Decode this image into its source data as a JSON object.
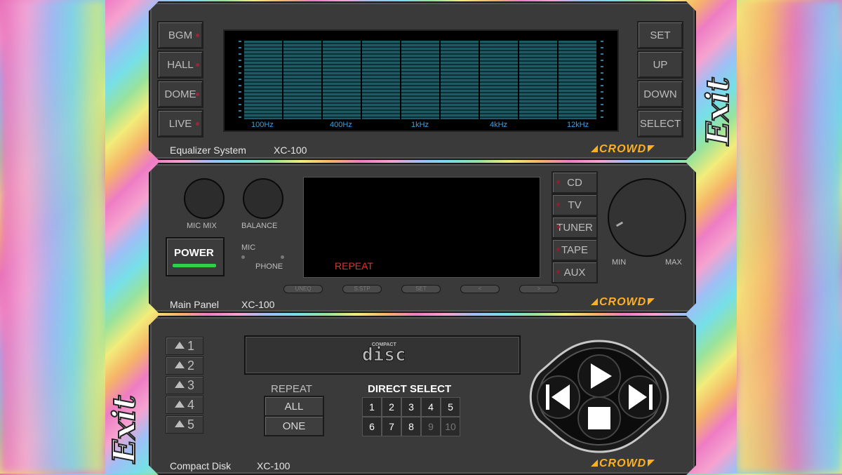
{
  "exit_top": "Exit",
  "exit_bottom": "Exit",
  "equalizer": {
    "modes": [
      "BGM",
      "HALL",
      "DOME",
      "LIVE"
    ],
    "controls": [
      "SET",
      "UP",
      "DOWN",
      "SELECT"
    ],
    "freq_labels": [
      "100Hz",
      "400Hz",
      "1kHz",
      "4kHz",
      "12kHz"
    ],
    "footer_title": "Equalizer System",
    "footer_model": "XC-100",
    "brand": "CROWD"
  },
  "main": {
    "knob1_label": "MIC MIX",
    "knob2_label": "BALANCE",
    "power_label": "POWER",
    "jack_mic": "MIC",
    "jack_phone": "PHONE",
    "display_text": "REPEAT",
    "sources": [
      "CD",
      "TV",
      "TUNER",
      "TAPE",
      "AUX"
    ],
    "vol_min": "MIN",
    "vol_max": "MAX",
    "footer_title": "Main Panel",
    "footer_model": "XC-100",
    "brand": "CROWD",
    "pill_labels": [
      "UNEQ",
      "S.STP",
      "SET",
      "<",
      ">"
    ]
  },
  "cd": {
    "ejects": [
      "1",
      "2",
      "3",
      "4",
      "5"
    ],
    "logo_top": "COMPACT",
    "logo_main": "disc",
    "repeat_title": "REPEAT",
    "repeat_all": "ALL",
    "repeat_one": "ONE",
    "direct_title": "DIRECT SELECT",
    "numbers_row1": [
      "1",
      "2",
      "3",
      "4",
      "5"
    ],
    "numbers_row2": [
      "6",
      "7",
      "8",
      "9",
      "10"
    ],
    "footer_title": "Compact Disk",
    "footer_model": "XC-100",
    "brand": "CROWD"
  }
}
